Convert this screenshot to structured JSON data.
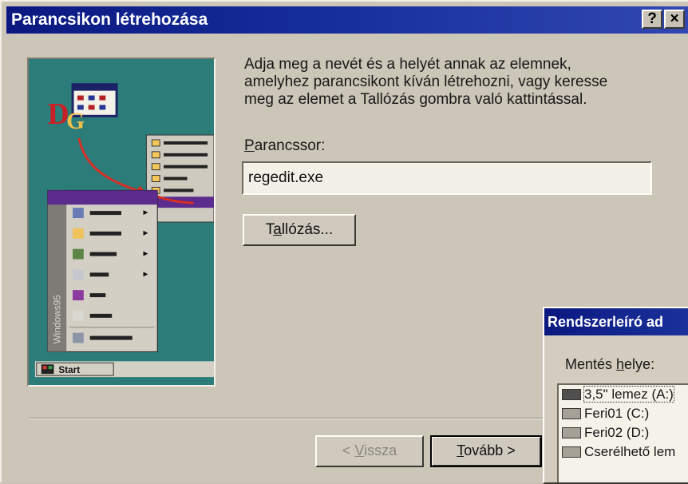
{
  "window": {
    "title": "Parancsikon létrehozása",
    "help_label": "?",
    "close_label": "×"
  },
  "instructions": "Adja meg a nevét és a helyét annak az elemnek,\namelyhez parancsikont kíván létrehozni, vagy keresse\nmeg az elemet a Tallózás gombra való kattintással.",
  "command_line": {
    "label_prefix": "",
    "label_accel": "P",
    "label_rest": "arancssor:",
    "value": "regedit.exe"
  },
  "browse_button": {
    "prefix": "T",
    "accel": "a",
    "rest": "llózás..."
  },
  "back_button": {
    "prefix": "< ",
    "accel": "V",
    "rest": "issza"
  },
  "next_button": {
    "accel": "T",
    "rest": "ovább >"
  },
  "sub_window": {
    "title": "Rendszerleíró ad",
    "save_label_prefix": "Mentés ",
    "save_label_accel": "h",
    "save_label_rest": "elye:",
    "drives": [
      {
        "label": "3,5\" lemez (A:)",
        "icon": "floppy-drive-icon",
        "selected": true
      },
      {
        "label": "Feri01 (C:)",
        "icon": "hard-drive-icon",
        "selected": false
      },
      {
        "label": "Feri02 (D:)",
        "icon": "hard-drive-icon",
        "selected": false
      },
      {
        "label": "Cserélhető lem",
        "icon": "removable-drive-icon",
        "selected": false
      }
    ]
  },
  "illustration": {
    "start_label": "Start",
    "side_label": "Windows95"
  },
  "colors": {
    "title_bar": "#0b1880",
    "dialog_bg": "#ccc6b8",
    "illustration_bg": "#2c7d79",
    "menu_highlight": "#5b2b8e"
  }
}
